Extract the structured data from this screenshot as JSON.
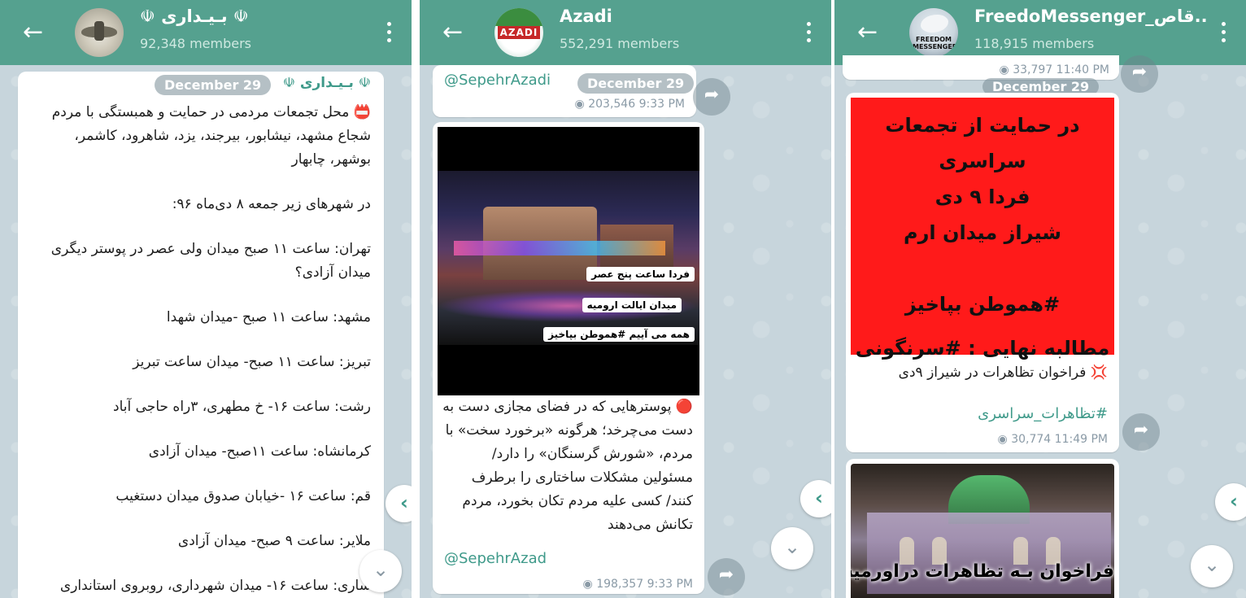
{
  "panels": [
    {
      "header": {
        "title": "☫ بـیـداری ☫",
        "members": "92,348 members"
      },
      "message": {
        "author": "☫ بـیـداری ☫",
        "date": "December 29",
        "paragraphs": [
          "📛 محل تجمعات مردمی در حمایت و همبستگی با مردم شجاع مشهد، نیشابور، بیرجند، یزد، شاهرود، کاشمر، بوشهر، چابهار",
          "در شهرهای زیر جمعه ۸ دی‌ماه ۹۶:",
          "تهران: ساعت ۱۱ صبح میدان ولی عصر در پوستر دیگری میدان آزادی؟",
          "مشهد: ساعت ۱۱ صبح -میدان شهدا",
          "تبریز: ساعت ۱۱ صبح- میدان ساعت تبریز",
          "رشت: ساعت ۱۶- خ مطهری، ۳راه حاجی آباد",
          "کرمانشاه: ساعت ۱۱صبح- میدان آزادی",
          "قم: ساعت ۱۶ -خیابان صدوق میدان دستغیب",
          "ملایر: ساعت ۹ صبح- میدان آزادی",
          "ساری: ساعت ۱۶- میدان شهرداری، روبروی استانداری"
        ]
      }
    },
    {
      "header": {
        "title": "Azadi",
        "members": "552,291 members",
        "avatar_text": "AZADI"
      },
      "top_message": {
        "link": "@SepehrAzadi",
        "date": "December 29",
        "views": "203,546",
        "time": "9:33 PM"
      },
      "image_tags": [
        "فردا ساعت پنج عصر",
        "میدان ایالت ارومیه",
        "همه می آییم #هموطن بپاخیز"
      ],
      "message": {
        "text": "🔴 پوسترهایی که در فضای مجازی دست به دست می‌چرخد؛ هرگونه «برخورد سخت» با مردم، «شورش گرسنگان» را دارد/ مسئولین مشکلات ساختاری را برطرف کنند/ کسی علیه مردم تکان بخورد، مردم تکانش می‌دهند",
        "link": "@SepehrAzad",
        "views": "198,357",
        "time": "9:33 PM"
      }
    },
    {
      "header": {
        "title": "FreedoMessenger_قاص..",
        "members": "118,915 members",
        "avatar_text": "FREEDOM MESSENGER"
      },
      "top_meta": {
        "views": "33,797",
        "time": "11:40 PM",
        "date": "December 29"
      },
      "poster_lines": [
        "در حمایت از تجمعات سراسری",
        "فردا ۹ دی",
        "شیراز میدان ارم",
        "",
        "#هموطن بپاخیز",
        "مطالبه نهایی : #سرنگونی"
      ],
      "message": {
        "text": "💢 فراخوان تظاهرات در شیراز ۹دی",
        "hashtag": "#تظاهرات_سراسری",
        "views": "30,774",
        "time": "11:49 PM"
      },
      "second_image_caption": "فراخوان بـه تظاهرات دراورمیه"
    }
  ],
  "icons": {
    "back": "←",
    "share": "➦",
    "chevron_left": "‹",
    "chevron_down": "⌄",
    "eye": "◉"
  }
}
